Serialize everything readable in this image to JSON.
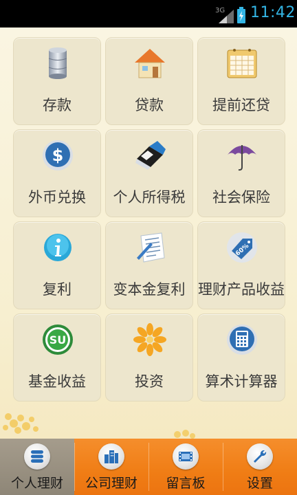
{
  "status_bar": {
    "network": "3G",
    "time": "11:42",
    "icons": [
      "signal-icon",
      "battery-icon"
    ]
  },
  "grid": {
    "items": [
      {
        "label": "存款",
        "icon": "database-icon"
      },
      {
        "label": "贷款",
        "icon": "house-icon"
      },
      {
        "label": "提前还贷",
        "icon": "calendar-icon"
      },
      {
        "label": "外币兑换",
        "icon": "dollar-icon"
      },
      {
        "label": "个人所得税",
        "icon": "eraser-icon"
      },
      {
        "label": "社会保险",
        "icon": "umbrella-icon"
      },
      {
        "label": "复利",
        "icon": "info-icon"
      },
      {
        "label": "变本金复利",
        "icon": "document-icon"
      },
      {
        "label": "理财产品收益",
        "icon": "price-tag-icon"
      },
      {
        "label": "基金收益",
        "icon": "stumbleupon-icon"
      },
      {
        "label": "投资",
        "icon": "flower-icon"
      },
      {
        "label": "算术计算器",
        "icon": "calculator-icon"
      }
    ]
  },
  "tabs": [
    {
      "label": "个人理财",
      "icon": "stack-icon",
      "active": true
    },
    {
      "label": "公司理财",
      "icon": "buildings-icon",
      "active": false
    },
    {
      "label": "留言板",
      "icon": "film-icon",
      "active": false
    },
    {
      "label": "设置",
      "icon": "wrench-icon",
      "active": false
    }
  ],
  "colors": {
    "accent": "#33b5e5",
    "tab_bar": "#f07d15",
    "tab_active": "#9a9182",
    "background": "#f8f1d8",
    "tile": "#ede6cd"
  }
}
